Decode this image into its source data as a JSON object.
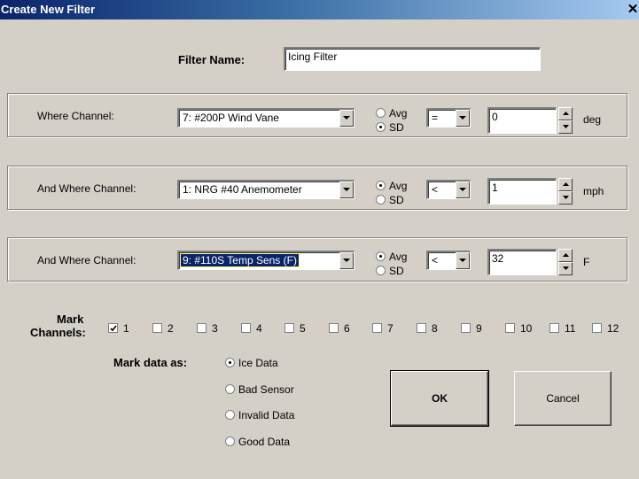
{
  "window": {
    "title": "Create New Filter",
    "close_symbol": "✕"
  },
  "filter_name": {
    "label": "Filter Name:",
    "value": "Icing Filter"
  },
  "rows": [
    {
      "label": "Where Channel:",
      "channel": "7: #200P Wind Vane",
      "avg_label": "Avg",
      "sd_label": "SD",
      "selected_stat": "SD",
      "operator": "=",
      "value": "0",
      "unit": "deg"
    },
    {
      "label": "And Where Channel:",
      "channel": "1: NRG #40 Anemometer",
      "avg_label": "Avg",
      "sd_label": "SD",
      "selected_stat": "Avg",
      "operator": "<",
      "value": "1",
      "unit": "mph"
    },
    {
      "label": "And Where Channel:",
      "channel": "9: #110S Temp Sens (F)",
      "avg_label": "Avg",
      "sd_label": "SD",
      "selected_stat": "Avg",
      "operator": "<",
      "value": "32",
      "unit": "F"
    }
  ],
  "mark_channels": {
    "label_line1": "Mark",
    "label_line2": "Channels:",
    "items": [
      {
        "label": "1",
        "checked": true
      },
      {
        "label": "2",
        "checked": false
      },
      {
        "label": "3",
        "checked": false
      },
      {
        "label": "4",
        "checked": false
      },
      {
        "label": "5",
        "checked": false
      },
      {
        "label": "6",
        "checked": false
      },
      {
        "label": "7",
        "checked": false
      },
      {
        "label": "8",
        "checked": false
      },
      {
        "label": "9",
        "checked": false
      },
      {
        "label": "10",
        "checked": false
      },
      {
        "label": "11",
        "checked": false
      },
      {
        "label": "12",
        "checked": false
      }
    ]
  },
  "mark_data": {
    "label": "Mark data as:",
    "options": [
      {
        "label": "Ice Data",
        "selected": true
      },
      {
        "label": "Bad Sensor",
        "selected": false
      },
      {
        "label": "Invalid Data",
        "selected": false
      },
      {
        "label": "Good Data",
        "selected": false
      }
    ]
  },
  "buttons": {
    "ok": "OK",
    "cancel": "Cancel"
  },
  "colors": {
    "titlebar_start": "#0a246a",
    "titlebar_end": "#a6caf0",
    "dialog_face": "#d4d0c8",
    "selection": "#0a246a"
  }
}
